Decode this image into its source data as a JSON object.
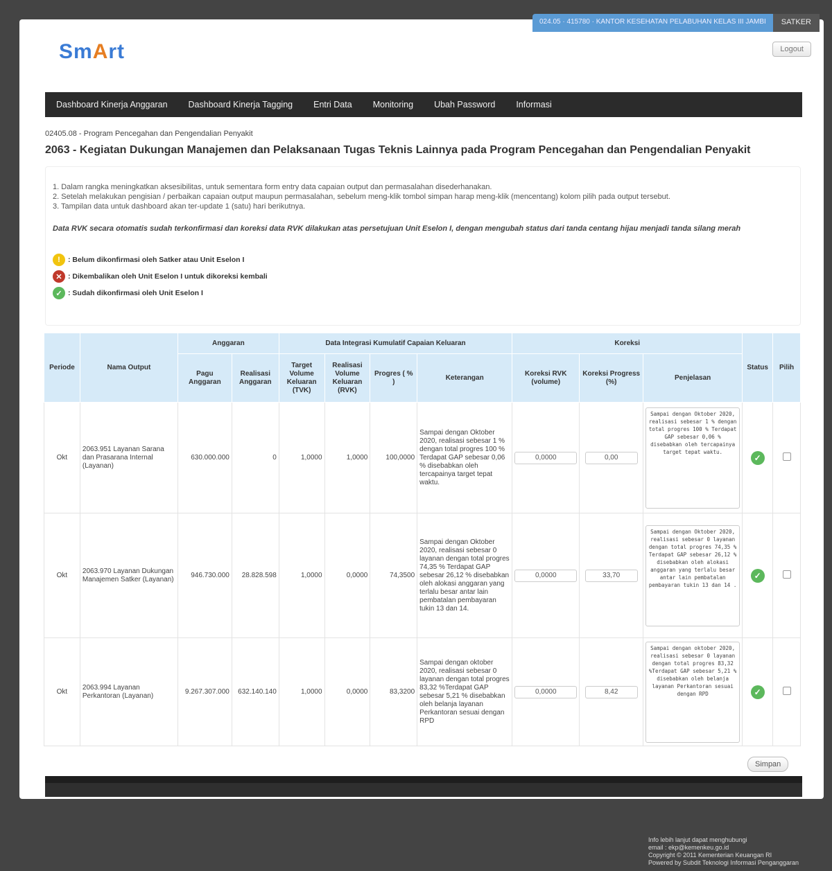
{
  "topbar": {
    "satker_info": "024.05 · 415780 · KANTOR KESEHATAN PELABUHAN KELAS III JAMBI",
    "satker_button": "SATKER"
  },
  "header": {
    "logo_text_1": "Sm",
    "logo_text_2": "A",
    "logo_text_3": "rt",
    "logout_label": "Logout"
  },
  "nav": {
    "items": [
      "Dashboard Kinerja Anggaran",
      "Dashboard Kinerja Tagging",
      "Entri Data",
      "Monitoring",
      "Ubah Password",
      "Informasi"
    ]
  },
  "main": {
    "program": "02405.08 - Program Pencegahan dan Pengendalian Penyakit",
    "title": "2063 - Kegiatan Dukungan Manajemen dan Pelaksanaan Tugas Teknis Lainnya pada Program Pencegahan dan Pengendalian Penyakit",
    "notes": [
      "1. Dalam rangka meningkatkan aksesibilitas, untuk sementara form entry data capaian output dan permasalahan disederhanakan.",
      "2. Setelah melakukan pengisian / perbaikan capaian output maupun permasalahan, sebelum meng-klik tombol simpan harap meng-klik (mencentang) kolom pilih pada output tersebut.",
      "3. Tampilan data untuk dashboard akan ter-update 1 (satu) hari berikutnya."
    ],
    "rvk_note": "Data RVK secara otomatis sudah terkonfirmasi dan koreksi data RVK dilakukan atas persetujuan Unit Eselon I, dengan mengubah status dari tanda centang hijau menjadi tanda silang merah",
    "legend": [
      {
        "icon": "warning-icon",
        "text": ": Belum dikonfirmasi oleh Satker atau Unit Eselon I"
      },
      {
        "icon": "reject-icon",
        "text": ": Dikembalikan oleh Unit Eselon I untuk dikoreksi kembali"
      },
      {
        "icon": "check-icon",
        "text": ": Sudah dikonfirmasi oleh Unit Eselon I"
      }
    ]
  },
  "table": {
    "group_headers": {
      "anggaran": "Anggaran",
      "data_integrasi": "Data Integrasi Kumulatif Capaian Keluaran",
      "koreksi": "Koreksi"
    },
    "headers": {
      "periode": "Periode",
      "nama_output": "Nama Output",
      "pagu": "Pagu Anggaran",
      "realisasi": "Realisasi Anggaran",
      "tvk": "Target Volume Keluaran (TVK)",
      "rvk": "Realisasi Volume Keluaran (RVK)",
      "progres": "Progres ( % )",
      "keterangan": "Keterangan",
      "koreksi_rvk": "Koreksi RVK (volume)",
      "koreksi_progres": "Koreksi Progress (%)",
      "penjelasan": "Penjelasan",
      "status": "Status",
      "pilih": "Pilih"
    },
    "rows": [
      {
        "periode": "Okt",
        "nama_output": "2063.951 Layanan Sarana dan Prasarana Internal (Layanan)",
        "pagu": "630.000.000",
        "realisasi": "0",
        "tvk": "1,0000",
        "rvk": "1,0000",
        "progres": "100,0000",
        "keterangan": "Sampai dengan Oktober 2020, realisasi sebesar 1 % dengan total progres 100 % Terdapat GAP sebesar 0,06 % disebabkan oleh tercapainya target tepat waktu.",
        "koreksi_rvk": "0,0000",
        "koreksi_progres": "0,00",
        "penjelasan": "Sampai dengan Oktober 2020, realisasi sebesar 1 % dengan total progres 100 % Terdapat GAP sebesar 0,06 % disebabkan oleh tercapainya target tepat waktu."
      },
      {
        "periode": "Okt",
        "nama_output": "2063.970 Layanan Dukungan Manajemen Satker (Layanan)",
        "pagu": "946.730.000",
        "realisasi": "28.828.598",
        "tvk": "1,0000",
        "rvk": "0,0000",
        "progres": "74,3500",
        "keterangan": "Sampai dengan Oktober 2020, realisasi sebesar 0 layanan dengan total progres 74,35 % Terdapat GAP sebesar 26,12 % disebabkan oleh alokasi anggaran yang terlalu besar antar lain pembatalan pembayaran tukin 13 dan 14.",
        "koreksi_rvk": "0,0000",
        "koreksi_progres": "33,70",
        "penjelasan": "Sampai dengan Oktober 2020, realisasi sebesar 0 layanan dengan total progres 74,35 % Terdapat GAP sebesar 26,12 % disebabkan oleh alokasi anggaran yang terlalu besar antar lain pembatalan pembayaran tukin 13 dan 14 ."
      },
      {
        "periode": "Okt",
        "nama_output": "2063.994 Layanan Perkantoran (Layanan)",
        "pagu": "9.267.307.000",
        "realisasi": "632.140.140",
        "tvk": "1,0000",
        "rvk": "0,0000",
        "progres": "83,3200",
        "keterangan": "Sampai dengan oktober 2020, realisasi sebesar 0 layanan dengan total progres 83,32 %Terdapat GAP sebesar 5,21 % disebabkan oleh belanja layanan Perkantoran sesuai dengan RPD",
        "koreksi_rvk": "0,0000",
        "koreksi_progres": "8,42",
        "penjelasan": "Sampai dengan oktober 2020, realisasi sebesar 0 layanan dengan total progres 83,32 %Terdapat GAP sebesar 5,21 % disebabkan oleh belanja layanan Perkantoran sesuai dengan RPD"
      }
    ],
    "save_label": "Simpan"
  },
  "footer": {
    "lines": [
      "Info lebih lanjut dapat menghubungi",
      "email : ekp@kemenkeu.go.id",
      "Copyright © 2011 Kementerian Keuangan RI",
      "Powered by Subdit Teknologi Informasi Penganggaran"
    ]
  }
}
